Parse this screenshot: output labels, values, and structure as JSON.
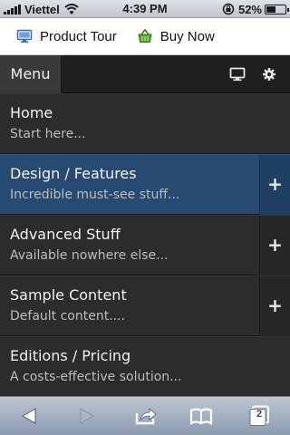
{
  "status_bar": {
    "carrier": "Viettel",
    "time": "4:39 PM",
    "battery_percent": "52%",
    "battery_level": 0.52
  },
  "top_bar": {
    "links": [
      {
        "label": "Product Tour",
        "icon": "monitor-icon"
      },
      {
        "label": "Buy Now",
        "icon": "basket-icon"
      }
    ]
  },
  "menu_bar": {
    "menu_label": "Menu",
    "icons": [
      "monitor-icon",
      "gear-icon"
    ]
  },
  "menu_items": [
    {
      "title": "Home",
      "subtitle": "Start here...",
      "expandable": false,
      "active": false
    },
    {
      "title": "Design / Features",
      "subtitle": "Incredible must-see stuff...",
      "expandable": true,
      "active": true,
      "expand_label": "+"
    },
    {
      "title": "Advanced Stuff",
      "subtitle": "Available nowhere else...",
      "expandable": true,
      "active": false,
      "expand_label": "+"
    },
    {
      "title": "Sample Content",
      "subtitle": "Default content....",
      "expandable": true,
      "active": false,
      "expand_label": "+"
    },
    {
      "title": "Editions / Pricing",
      "subtitle": "A costs-effective solution...",
      "expandable": false,
      "active": false
    }
  ],
  "toolbar": {
    "tab_count": "2",
    "icons": [
      "back-arrow-icon",
      "forward-arrow-icon",
      "share-icon",
      "bookmarks-icon",
      "pages-icon"
    ]
  },
  "colors": {
    "active_item": "#264a72",
    "menu_bar": "#1f1f1f",
    "list_background": "#2c2c2c"
  }
}
